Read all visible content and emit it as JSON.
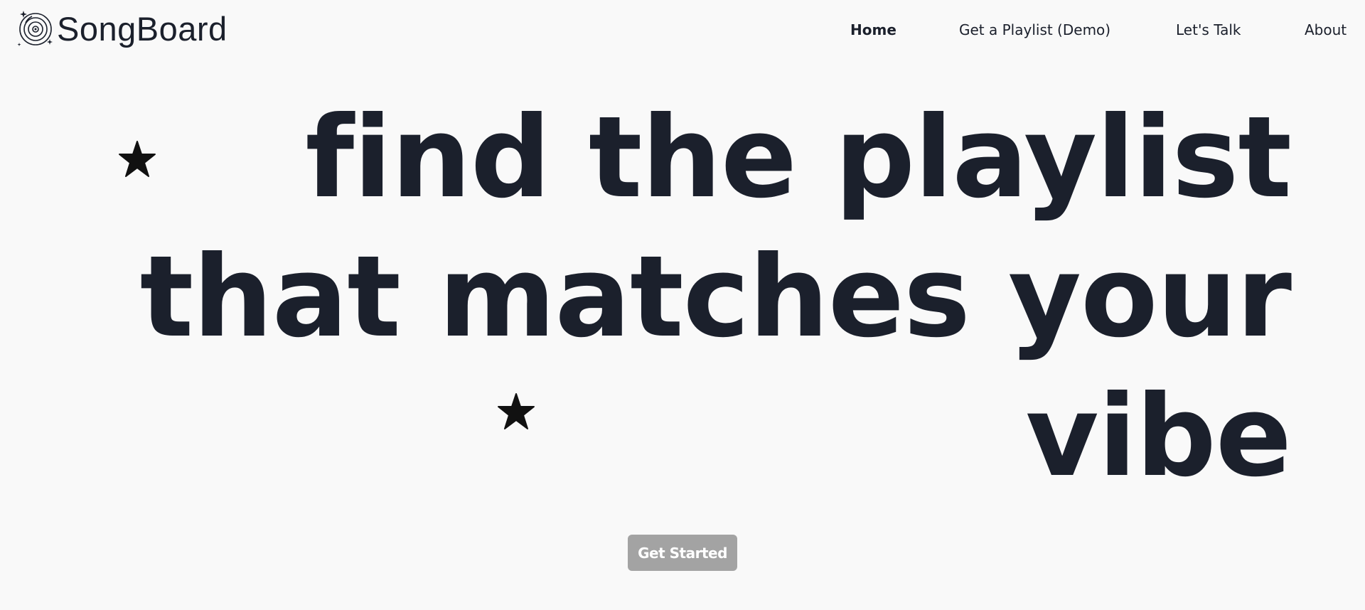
{
  "header": {
    "logo_text": "SongBoard",
    "logo_icon": "vinyl-record-icon"
  },
  "nav": {
    "items": [
      {
        "label": "Home",
        "active": true
      },
      {
        "label": "Get a Playlist (Demo)",
        "active": false
      },
      {
        "label": "Let's Talk",
        "active": false
      },
      {
        "label": "About",
        "active": false
      }
    ]
  },
  "hero": {
    "lines": [
      "find the playlist",
      "that matches your",
      "vibe"
    ],
    "decorations": [
      "star-icon",
      "star-icon"
    ]
  },
  "cta": {
    "label": "Get Started"
  },
  "colors": {
    "background": "#f9f9f9",
    "text": "#1b202c",
    "button_bg": "#a3a3a3",
    "button_text": "#ffffff"
  }
}
